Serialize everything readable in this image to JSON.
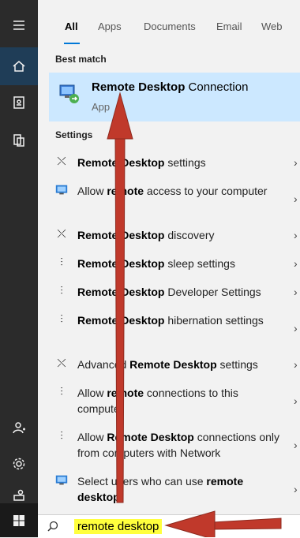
{
  "tabs": [
    "All",
    "Apps",
    "Documents",
    "Email",
    "Web"
  ],
  "best_match": {
    "header": "Best match",
    "title_bold": "Remote Desktop",
    "title_rest": " Connection",
    "subtitle": "App"
  },
  "settings_header": "Settings",
  "items": [
    {
      "icon": "remote-settings-icon",
      "pre": "",
      "bold": "Remote Desktop",
      "post": " settings"
    },
    {
      "icon": "monitor-icon",
      "pre": "Allow ",
      "bold": "remote",
      "post": " access to your computer"
    },
    {
      "icon": "remote-settings-icon",
      "pre": "",
      "bold": "Remote Desktop",
      "post": " discovery"
    },
    {
      "icon": "sliders-icon",
      "pre": "",
      "bold": "Remote Desktop",
      "post": " sleep settings"
    },
    {
      "icon": "sliders-icon",
      "pre": "",
      "bold": "Remote Desktop",
      "post": " Developer Settings"
    },
    {
      "icon": "sliders-icon",
      "pre": "",
      "bold": "Remote Desktop",
      "post": " hibernation settings"
    },
    {
      "icon": "remote-settings-icon",
      "pre": "Advanced ",
      "bold": "Remote Desktop",
      "post": " settings"
    },
    {
      "icon": "sliders-icon",
      "pre": "Allow ",
      "bold": "remote",
      "post": " connections to this computer"
    },
    {
      "icon": "sliders-icon",
      "pre": "Allow ",
      "bold": "Remote Desktop",
      "post": " connections only from computers with Network"
    },
    {
      "icon": "monitor-icon",
      "pre": "Select users who can use ",
      "bold": "remote desktop",
      "post": ""
    }
  ],
  "chevron": "›",
  "search": {
    "query": "remote desktop"
  },
  "colors": {
    "accent": "#0078d7",
    "highlight": "#cce8ff",
    "query_highlight": "#ffff3d",
    "arrow": "#c0392b",
    "rail": "#2b2b2b"
  }
}
